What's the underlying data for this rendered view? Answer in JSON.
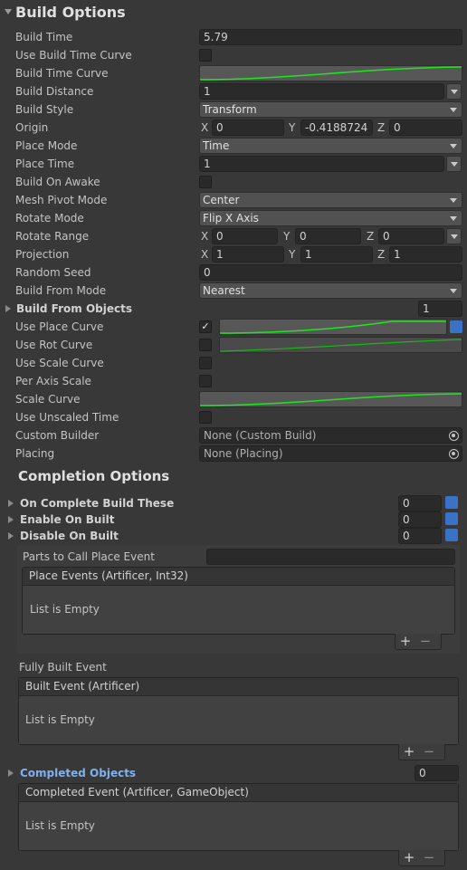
{
  "build_options": {
    "title": "Build Options",
    "build_time": {
      "label": "Build Time",
      "value": "5.79"
    },
    "use_build_time_curve": {
      "label": "Use Build Time Curve"
    },
    "build_time_curve": {
      "label": "Build Time Curve"
    },
    "build_distance": {
      "label": "Build Distance",
      "value": "1"
    },
    "build_style": {
      "label": "Build Style",
      "value": "Transform"
    },
    "origin": {
      "label": "Origin",
      "x": "0",
      "y": "-0.4188724",
      "z": "0"
    },
    "place_mode": {
      "label": "Place Mode",
      "value": "Time"
    },
    "place_time": {
      "label": "Place Time",
      "value": "1"
    },
    "build_on_awake": {
      "label": "Build On Awake"
    },
    "mesh_pivot_mode": {
      "label": "Mesh Pivot Mode",
      "value": "Center"
    },
    "rotate_mode": {
      "label": "Rotate Mode",
      "value": "Flip X Axis"
    },
    "rotate_range": {
      "label": "Rotate Range",
      "x": "0",
      "y": "0",
      "z": "0"
    },
    "projection": {
      "label": "Projection",
      "x": "1",
      "y": "1",
      "z": "1"
    },
    "random_seed": {
      "label": "Random Seed",
      "value": "0"
    },
    "build_from_mode": {
      "label": "Build From Mode",
      "value": "Nearest"
    },
    "build_from_objects": {
      "label": "Build From Objects",
      "count": "1"
    },
    "use_place_curve": {
      "label": "Use Place Curve",
      "checked": true
    },
    "use_rot_curve": {
      "label": "Use Rot Curve"
    },
    "use_scale_curve": {
      "label": "Use Scale Curve"
    },
    "per_axis_scale": {
      "label": "Per Axis Scale"
    },
    "scale_curve": {
      "label": "Scale Curve"
    },
    "use_unscaled_time": {
      "label": "Use Unscaled Time"
    },
    "custom_builder": {
      "label": "Custom Builder",
      "value": "None (Custom Build)"
    },
    "placing": {
      "label": "Placing",
      "value": "None (Placing)"
    },
    "axis_x": "X",
    "axis_y": "Y",
    "axis_z": "Z"
  },
  "completion_options": {
    "title": "Completion Options",
    "on_complete_build_these": {
      "label": "On Complete Build These",
      "count": "0"
    },
    "enable_on_built": {
      "label": "Enable On Built",
      "count": "0"
    },
    "disable_on_built": {
      "label": "Disable On Built",
      "count": "0"
    },
    "parts_to_call_place_event": {
      "label": "Parts to Call Place Event",
      "value": ""
    },
    "place_events": {
      "header": "Place Events (Artificer, Int32)",
      "empty": "List is Empty"
    },
    "fully_built_event": {
      "label": "Fully Built Event"
    },
    "built_event": {
      "header": "Built Event (Artificer)",
      "empty": "List is Empty"
    },
    "completed_objects": {
      "label": "Completed Objects",
      "count": "0"
    },
    "completed_event": {
      "header": "Completed Event (Artificer, GameObject)",
      "empty": "List is Empty"
    },
    "add_symbol": "+",
    "remove_symbol": "−"
  },
  "colors": {
    "curve_line": "#1ee61e",
    "link_blue": "#7fb0f0",
    "accent_blue": "#3a72c8"
  },
  "icons": [
    "foldout-arrow-icon",
    "dropdown-arrow-icon",
    "check-icon",
    "object-picker-icon",
    "prefab-icon",
    "plus-icon",
    "minus-icon"
  ]
}
